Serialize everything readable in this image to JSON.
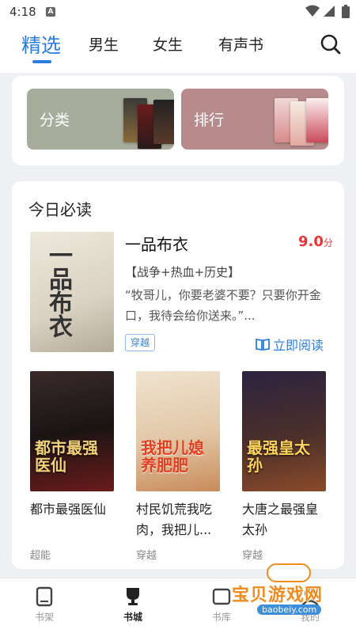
{
  "status": {
    "time": "4:18",
    "notif_glyph": "A"
  },
  "tabs": [
    {
      "label": "精选",
      "active": true
    },
    {
      "label": "男生"
    },
    {
      "label": "女生"
    },
    {
      "label": "有声书"
    }
  ],
  "quick": {
    "category_label": "分类",
    "ranking_label": "排行"
  },
  "today": {
    "title": "今日必读",
    "featured": {
      "title": "一品布衣",
      "score": "9.0",
      "score_unit": "分",
      "tags": "【战争+热血+历史】",
      "desc": "“牧哥儿，你要老婆不要？只要你开金口，我待会给你送来。”...",
      "badge": "穿越",
      "read_now": "立即阅读",
      "cover_text": "一品布衣"
    },
    "books": [
      {
        "name": "都市最强医仙",
        "tag": "超能",
        "cover_text": "都市最强医仙"
      },
      {
        "name": "村民饥荒我吃肉，我把儿...",
        "tag": "穿越",
        "cover_text": "我把儿媳养肥肥"
      },
      {
        "name": "大唐之最强皇太孙",
        "tag": "穿越",
        "cover_text": "最强皇太孙"
      }
    ]
  },
  "nav": [
    {
      "label": "书架"
    },
    {
      "label": "书城",
      "active": true
    },
    {
      "label": "书库"
    },
    {
      "label": "我的"
    }
  ],
  "watermark": {
    "text": "宝贝游戏网",
    "url": "baobeiy.com"
  },
  "colors": {
    "accent": "#2a7de1",
    "score": "#e63535",
    "category_tile": "#a7ad9c",
    "ranking_tile": "#b78b8b"
  }
}
